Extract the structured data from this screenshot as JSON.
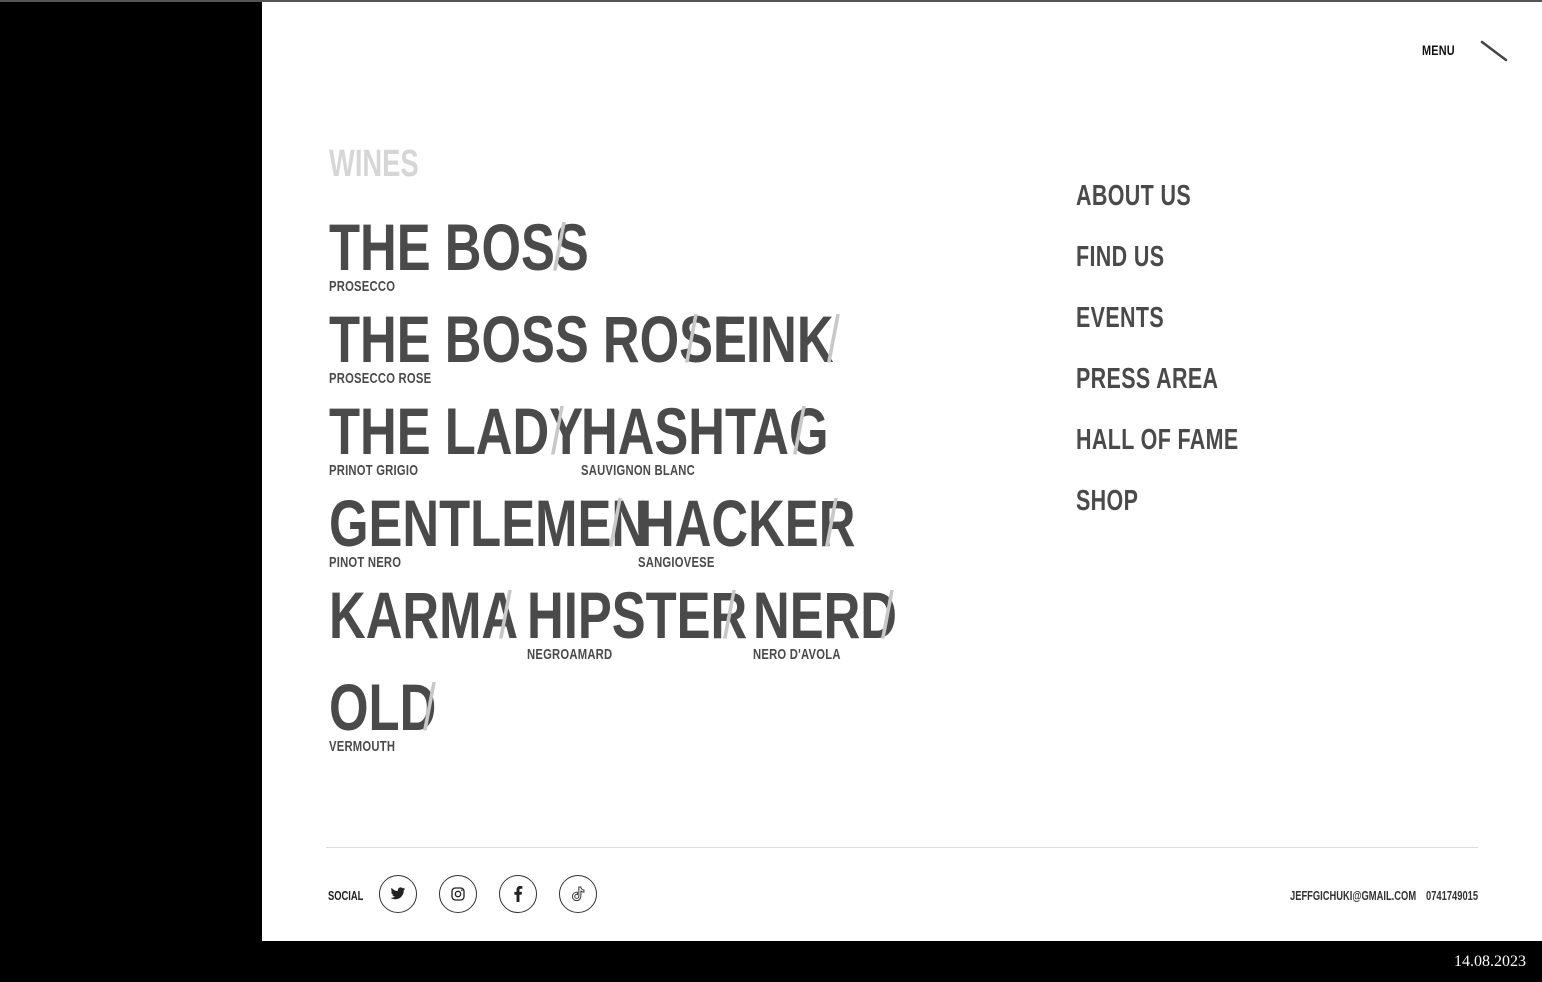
{
  "header": {
    "menu_label": "MENU"
  },
  "wines": {
    "heading": "WINES",
    "separator": "/",
    "items": [
      {
        "name": "THE BOSS",
        "sub": "PROSECCO"
      },
      {
        "name": "THE BOSS ROSE",
        "sub": "PROSECCO ROSE"
      },
      {
        "name": "LINK",
        "sub": ""
      },
      {
        "name": "THE LADY",
        "sub": "PRINOT GRIGIO"
      },
      {
        "name": "HASHTAG",
        "sub": "SAUVIGNON BLANC"
      },
      {
        "name": "GENTLEMEN",
        "sub": "PINOT NERO"
      },
      {
        "name": "HACKER",
        "sub": "SANGIOVESE"
      },
      {
        "name": "KARMA",
        "sub": ""
      },
      {
        "name": "HIPSTER",
        "sub": "NEGROAMARD"
      },
      {
        "name": "NERD",
        "sub": "NERO D'AVOLA"
      },
      {
        "name": "OLD",
        "sub": "VERMOUTH"
      }
    ]
  },
  "nav": {
    "items": [
      "ABOUT US",
      "FIND US",
      "EVENTS",
      "PRESS AREA",
      "HALL OF FAME",
      "SHOP"
    ]
  },
  "footer": {
    "social_label": "SOCIAL",
    "social_icons": [
      "twitter-icon",
      "instagram-icon",
      "facebook-icon",
      "tiktok-icon"
    ],
    "email": "JEFFGICHUKI@GMAIL.COM",
    "phone": "0741749015"
  },
  "timestamp": "14.08.2023",
  "colors": {
    "text": "#4a4a4a",
    "separator": "#c8c8c8",
    "heading": "#d6d6d6",
    "frame": "#000000"
  }
}
